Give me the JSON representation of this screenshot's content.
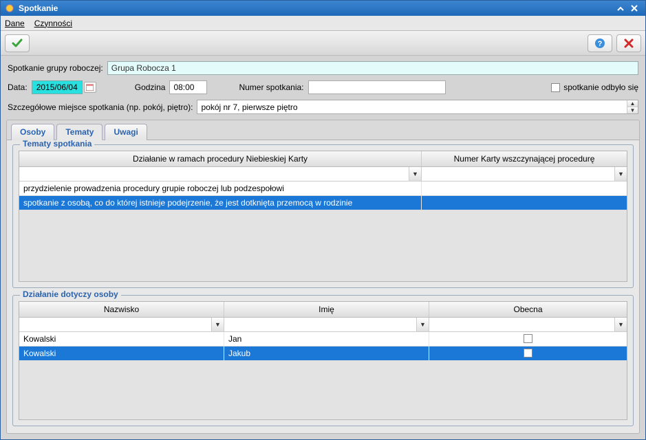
{
  "window": {
    "title": "Spotkanie"
  },
  "menu": {
    "dane": "Dane",
    "czynnosci": "Czynności"
  },
  "toolbar": {},
  "form": {
    "group_label": "Spotkanie grupy roboczej:",
    "group_value": "Grupa Robocza 1",
    "date_label": "Data:",
    "date_value": "2015/06/04",
    "time_label": "Godzina",
    "time_value": "08:00",
    "num_label": "Numer spotkania:",
    "num_value": "",
    "happened_label": "spotkanie odbyło się",
    "place_label": "Szczegółowe miejsce spotkania (np. pokój, piętro):",
    "place_value": "pokój nr 7, pierwsze piętro"
  },
  "tabs": {
    "osoby": "Osoby",
    "tematy": "Tematy",
    "uwagi": "Uwagi"
  },
  "topics": {
    "legend": "Tematy spotkania",
    "col1": "Działanie w ramach procedury Niebieskiej Karty",
    "col2": "Numer Karty wszczynającej procedurę",
    "rows": [
      {
        "dzialanie": "przydzielenie prowadzenia procedury grupie roboczej lub podzespołowi",
        "numer": "",
        "selected": false
      },
      {
        "dzialanie": "spotkanie z osobą, co do której istnieje podejrzenie, że jest dotknięta przemocą w rodzinie",
        "numer": "",
        "selected": true
      }
    ]
  },
  "persons": {
    "legend": "Działanie dotyczy osoby",
    "col1": "Nazwisko",
    "col2": "Imię",
    "col3": "Obecna",
    "rows": [
      {
        "nazwisko": "Kowalski",
        "imie": "Jan",
        "obecna": false,
        "selected": false
      },
      {
        "nazwisko": "Kowalski",
        "imie": "Jakub",
        "obecna": false,
        "selected": true
      }
    ]
  }
}
